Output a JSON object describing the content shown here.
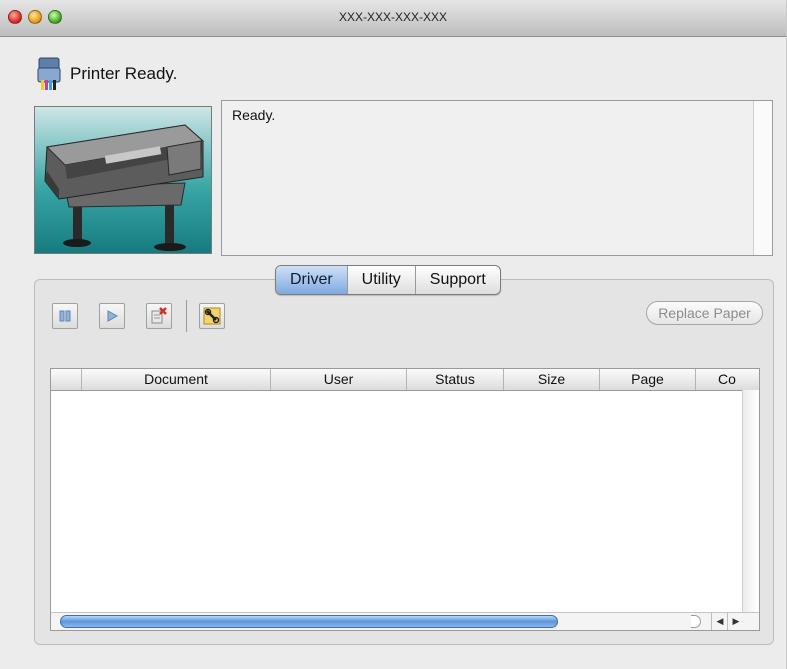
{
  "window": {
    "title": "XXX-XXX-XXX-XXX"
  },
  "status": {
    "headline": "Printer Ready.",
    "message": "Ready."
  },
  "tabs": [
    {
      "label": "Driver",
      "active": true
    },
    {
      "label": "Utility",
      "active": false
    },
    {
      "label": "Support",
      "active": false
    }
  ],
  "toolbar": {
    "pause_icon": "pause-icon",
    "resume_icon": "play-icon",
    "delete_icon": "delete-job-icon",
    "wrench_icon": "utility-wrench-icon",
    "replace_paper_label": "Replace Paper"
  },
  "jobs_table": {
    "columns": [
      "",
      "Document",
      "User",
      "Status",
      "Size",
      "Page",
      "Co"
    ],
    "rows": []
  },
  "colors": {
    "tab_active": "#7fa9e0",
    "scroll_thumb": "#5d95dd",
    "printer_bg": "#2a9aa0"
  }
}
